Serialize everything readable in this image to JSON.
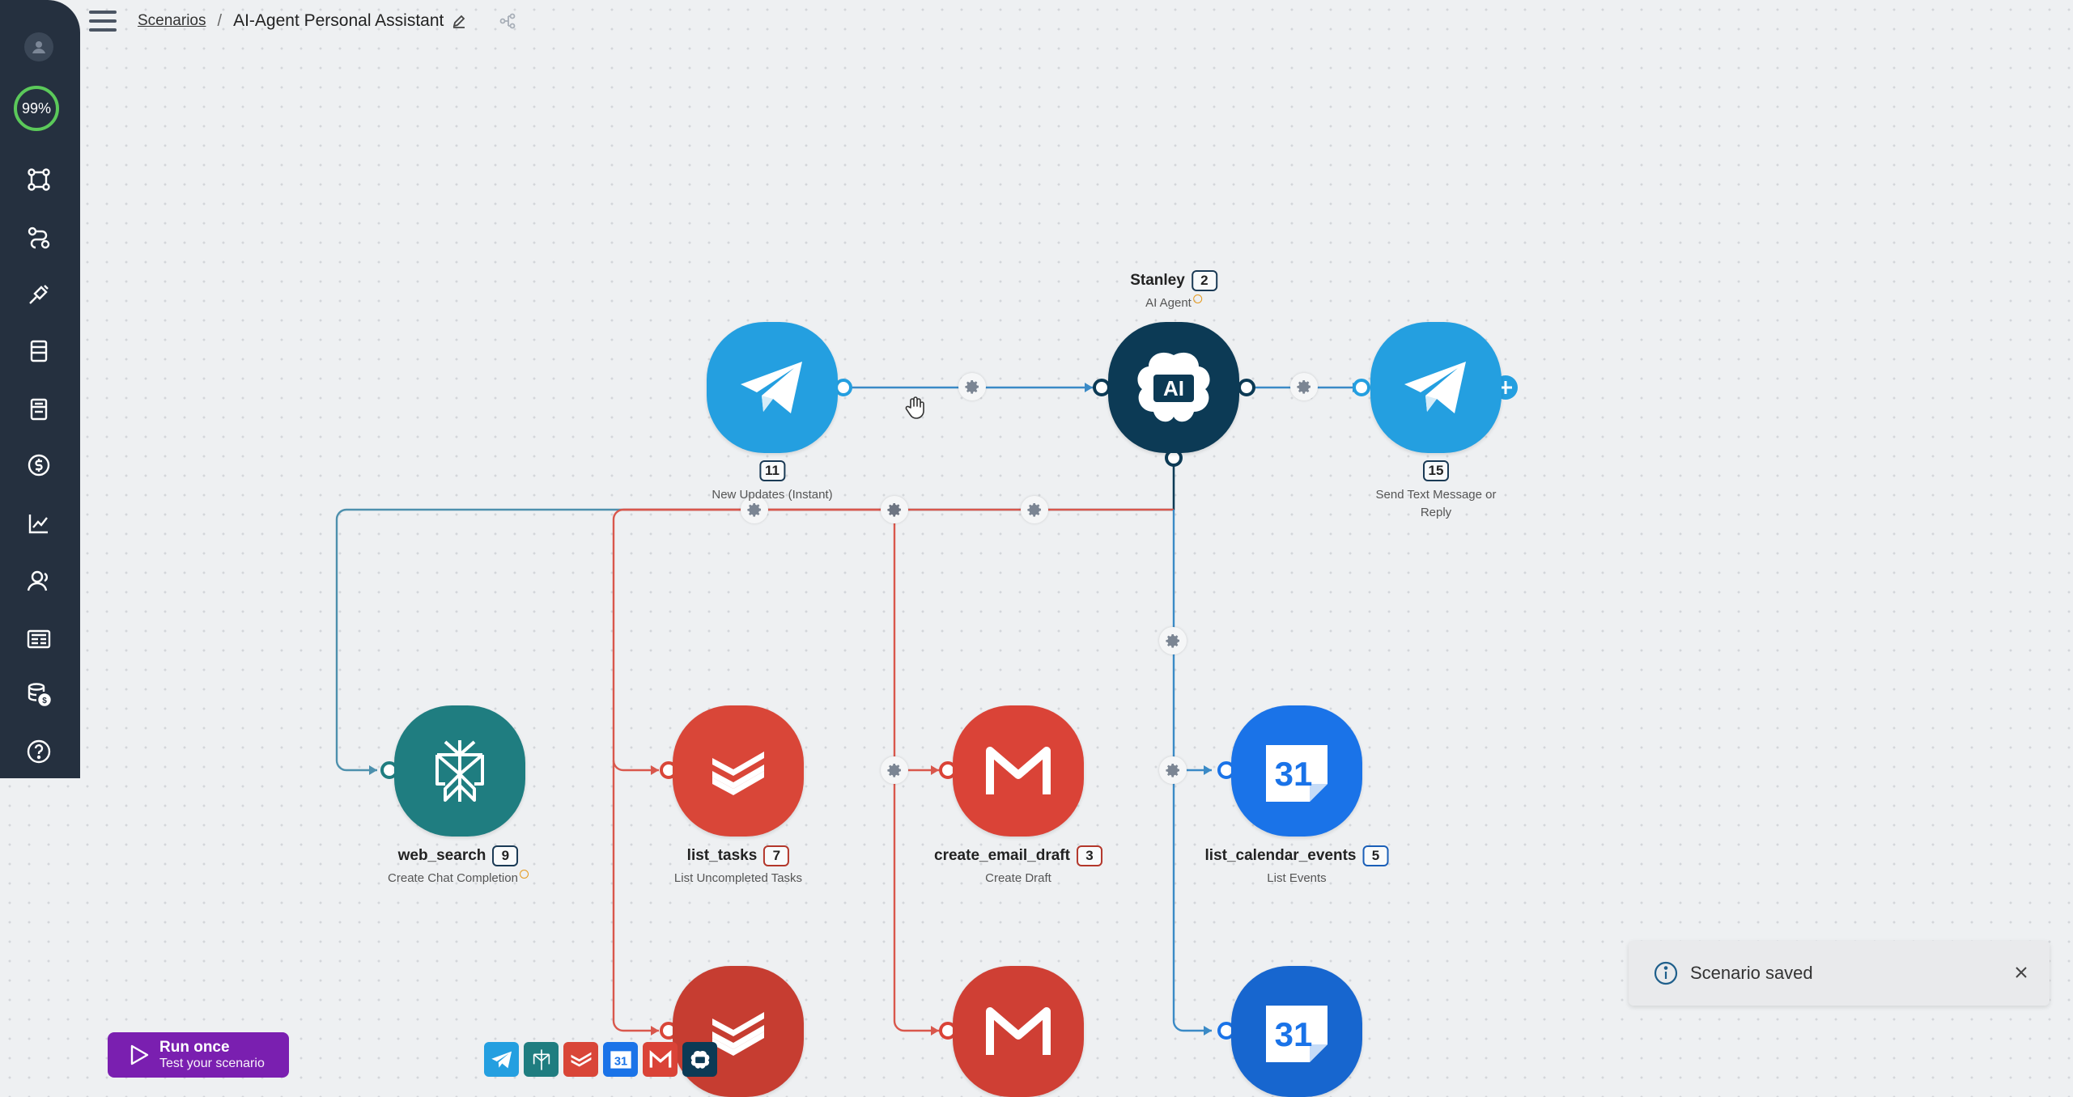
{
  "breadcrumb": {
    "root": "Scenarios",
    "separator": "/",
    "title": "AI-Agent Personal Assistant"
  },
  "sidebar": {
    "usage_percent": "99%",
    "items": [
      "scenarios-icon",
      "connections-icon",
      "webhooks-icon",
      "data-stores-icon",
      "data-structures-icon",
      "credits-icon",
      "analytics-icon",
      "team-icon",
      "templates-icon",
      "billing-icon",
      "help-icon"
    ]
  },
  "modules": [
    {
      "id": "telegram-trigger",
      "name": "",
      "number": "11",
      "subtitle": "New Updates (Instant)",
      "app": "Telegram"
    },
    {
      "id": "ai-agent",
      "name": "Stanley",
      "number": "2",
      "subtitle": "AI Agent",
      "app": "AI"
    },
    {
      "id": "telegram-send",
      "name": "",
      "number": "15",
      "subtitle": "Send Text Message or Reply",
      "app": "Telegram"
    },
    {
      "id": "web-search",
      "name": "web_search",
      "number": "9",
      "subtitle": "Create Chat Completion",
      "app": "Perplexity"
    },
    {
      "id": "list-tasks",
      "name": "list_tasks",
      "number": "7",
      "subtitle": "List Uncompleted Tasks",
      "app": "Todoist"
    },
    {
      "id": "create-email-draft",
      "name": "create_email_draft",
      "number": "3",
      "subtitle": "Create Draft",
      "app": "Gmail"
    },
    {
      "id": "list-calendar-events",
      "name": "list_calendar_events",
      "number": "5",
      "subtitle": "List Events",
      "app": "Google Calendar"
    }
  ],
  "ai_icon_text": "AI",
  "calendar_day": "31",
  "run_button": {
    "title": "Run once",
    "subtitle": "Test your scenario"
  },
  "toast": {
    "message": "Scenario saved"
  },
  "colors": {
    "sidebar": "#25303f",
    "telegram": "#249fe0",
    "ai": "#0c3a55",
    "perplexity": "#1f7d80",
    "todoist": "#d94638",
    "gmail": "#da4337",
    "gcal": "#1a73e8",
    "run": "#7a1fb0"
  }
}
